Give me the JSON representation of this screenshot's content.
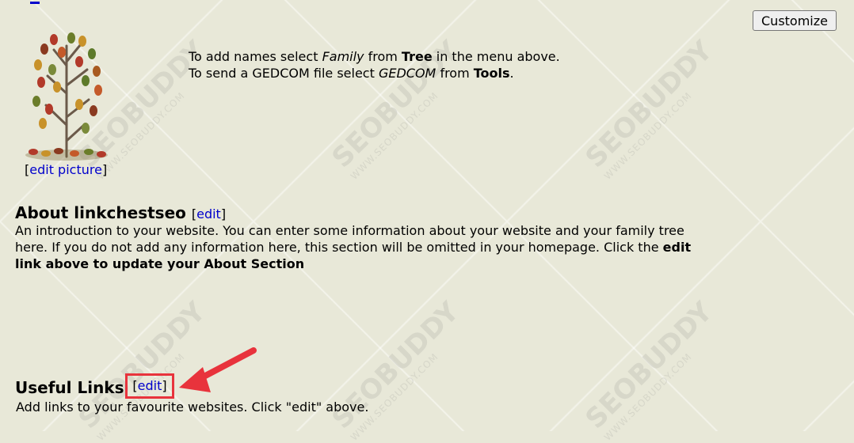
{
  "header": {
    "customize_label": "Customize"
  },
  "picture": {
    "icon": "family-tree-image",
    "edit_open": "[",
    "edit_label": "edit picture",
    "edit_close": "]"
  },
  "instructions": {
    "line1_a": "To add names select ",
    "line1_b": "Family",
    "line1_c": " from ",
    "line1_d": "Tree",
    "line1_e": " in the menu above.",
    "line2_a": "To send a GEDCOM file select ",
    "line2_b": "GEDCOM",
    "line2_c": " from ",
    "line2_d": "Tools",
    "line2_e": "."
  },
  "about": {
    "title": "About linkchestseo",
    "edit_open": "[",
    "edit_label": "edit",
    "edit_close": "]",
    "text_plain": "An introduction to your website. You can enter some information about your website and your family tree here. If you do not add any information here, this section will be omitted in your homepage. Click the ",
    "text_bold": "edit link above to update your About Section"
  },
  "useful_links": {
    "title": "Useful Links",
    "edit_open": "[",
    "edit_label": "edit",
    "edit_close": "]",
    "text": "Add links to your favourite websites. Click \"edit\" above."
  },
  "watermark": {
    "brand": "SEOBUDDY",
    "url": "WWW.SEOBUDDY.COM"
  },
  "colors": {
    "background": "#e8e8d8",
    "link": "#0000cc",
    "highlight": "#e8333c"
  }
}
